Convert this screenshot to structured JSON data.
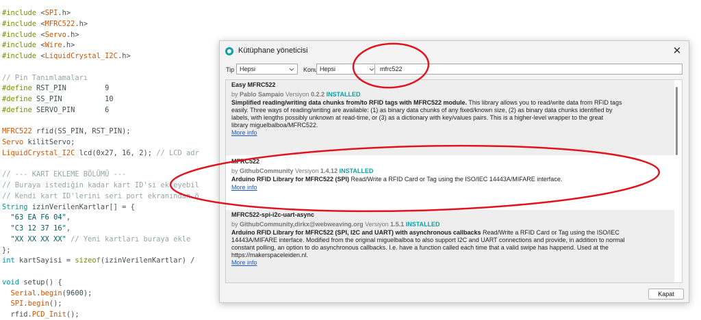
{
  "code": {
    "lines": [
      [
        {
          "c": "kw",
          "t": "#include "
        },
        {
          "c": "",
          "t": "<"
        },
        {
          "c": "lib",
          "t": "SPI"
        },
        {
          "c": "",
          "t": ".h>"
        }
      ],
      [
        {
          "c": "kw",
          "t": "#include "
        },
        {
          "c": "",
          "t": "<"
        },
        {
          "c": "lib",
          "t": "MFRC522"
        },
        {
          "c": "",
          "t": ".h>"
        }
      ],
      [
        {
          "c": "kw",
          "t": "#include "
        },
        {
          "c": "",
          "t": "<"
        },
        {
          "c": "lib",
          "t": "Servo"
        },
        {
          "c": "",
          "t": ".h>"
        }
      ],
      [
        {
          "c": "kw",
          "t": "#include "
        },
        {
          "c": "",
          "t": "<"
        },
        {
          "c": "lib",
          "t": "Wire"
        },
        {
          "c": "",
          "t": ".h>"
        }
      ],
      [
        {
          "c": "kw",
          "t": "#include "
        },
        {
          "c": "",
          "t": "<"
        },
        {
          "c": "lib",
          "t": "LiquidCrystal_I2C"
        },
        {
          "c": "",
          "t": ".h>"
        }
      ],
      [],
      [
        {
          "c": "cm",
          "t": "// Pin Tanımlamaları"
        }
      ],
      [
        {
          "c": "kw",
          "t": "#define "
        },
        {
          "c": "",
          "t": "RST_PIN         9"
        }
      ],
      [
        {
          "c": "kw",
          "t": "#define "
        },
        {
          "c": "",
          "t": "SS_PIN          10"
        }
      ],
      [
        {
          "c": "kw",
          "t": "#define "
        },
        {
          "c": "",
          "t": "SERVO_PIN       6"
        }
      ],
      [],
      [
        {
          "c": "lib",
          "t": "MFRC522"
        },
        {
          "c": "",
          "t": " rfid(SS_PIN, RST_PIN);"
        }
      ],
      [
        {
          "c": "lib",
          "t": "Servo"
        },
        {
          "c": "",
          "t": " kilitServo;"
        }
      ],
      [
        {
          "c": "lib",
          "t": "LiquidCrystal_I2C"
        },
        {
          "c": "",
          "t": " lcd(0x27, 16, 2); "
        },
        {
          "c": "cm",
          "t": "// LCD adr"
        }
      ],
      [],
      [
        {
          "c": "cm",
          "t": "// --- KART EKLEME BÖLÜMÜ ---"
        }
      ],
      [
        {
          "c": "cm",
          "t": "// Buraya istediğin kadar kart ID'si ekleyebil"
        }
      ],
      [
        {
          "c": "cm",
          "t": "// Kendi kart ID'lerini seri port ekranından ö"
        }
      ],
      [
        {
          "c": "ty",
          "t": "String"
        },
        {
          "c": "",
          "t": " izinVerilenKartlar[] = {"
        }
      ],
      [
        {
          "c": "",
          "t": "  "
        },
        {
          "c": "st",
          "t": "\"63 EA F6 04\""
        },
        {
          "c": "",
          "t": ","
        }
      ],
      [
        {
          "c": "",
          "t": "  "
        },
        {
          "c": "st",
          "t": "\"C3 12 37 16\""
        },
        {
          "c": "",
          "t": ","
        }
      ],
      [
        {
          "c": "",
          "t": "  "
        },
        {
          "c": "st",
          "t": "\"XX XX XX XX\""
        },
        {
          "c": "",
          "t": " "
        },
        {
          "c": "cm",
          "t": "// Yeni kartları buraya ekle"
        }
      ],
      [
        {
          "c": "",
          "t": "};"
        }
      ],
      [
        {
          "c": "ty",
          "t": "int"
        },
        {
          "c": "",
          "t": " kartSayisi = "
        },
        {
          "c": "kw",
          "t": "sizeof"
        },
        {
          "c": "",
          "t": "(izinVerilenKartlar) /"
        }
      ],
      [],
      [
        {
          "c": "ty",
          "t": "void"
        },
        {
          "c": "",
          "t": " setup() {"
        }
      ],
      [
        {
          "c": "",
          "t": "  "
        },
        {
          "c": "lib",
          "t": "Serial"
        },
        {
          "c": "",
          "t": "."
        },
        {
          "c": "lib",
          "t": "begin"
        },
        {
          "c": "",
          "t": "(9600);"
        }
      ],
      [
        {
          "c": "",
          "t": "  "
        },
        {
          "c": "lib",
          "t": "SPI"
        },
        {
          "c": "",
          "t": "."
        },
        {
          "c": "lib",
          "t": "begin"
        },
        {
          "c": "",
          "t": "();"
        }
      ],
      [
        {
          "c": "",
          "t": "  rfid."
        },
        {
          "c": "lib",
          "t": "PCD_Init"
        },
        {
          "c": "",
          "t": "();"
        }
      ]
    ]
  },
  "dialog": {
    "title": "Kütüphane yöneticisi",
    "close_glyph": "✕",
    "filters": {
      "tip_label": "Tip",
      "tip_value": "Hepsi",
      "konu_label": "Konu",
      "konu_value": "Hepsi",
      "search_value": "mfrc522"
    },
    "libraries": [
      {
        "name": "Easy MFRC522",
        "by_prefix": "by ",
        "author": "Pablo Sampaio",
        "version_label": " Versiyon ",
        "version": "0.2.2",
        "installed": "INSTALLED",
        "desc_bold": "Simplified reading/writing data chunks from/to RFID tags with MFRC522 module.",
        "desc_lines": [
          " This library allows you to read/write data from RFID tags",
          "easily. Three ways of reading/writing are available: (1) as binary data chunks of any fixed/known size, (2) as binary data chunks identified by",
          "labels, with lengths possibly unknown at read-time, or (3) as a dictionary with key/values pairs. This is a higher-level wrapper to the great",
          "library miguelbalboa/MFRC522."
        ],
        "more": "More info"
      },
      {
        "name": "MFRC522",
        "by_prefix": "by ",
        "author": "GithubCommunity",
        "version_label": " Versiyon ",
        "version": "1.4.12",
        "installed": "INSTALLED",
        "desc_bold": "Arduino RFID Library for MFRC522 (SPI)",
        "desc_lines": [
          " Read/Write a RFID Card or Tag using the ISO/IEC 14443A/MIFARE interface."
        ],
        "more": "More info"
      },
      {
        "name": "MFRC522-spi-i2c-uart-async",
        "by_prefix": "by ",
        "author": "GithubCommunity,dirkx@webweaving.org",
        "version_label": " Versiyon ",
        "version": "1.5.1",
        "installed": "INSTALLED",
        "desc_bold": "Arduino RFID Library for MFRC522 (SPI, I2C and UART) with asynchronous callbacks",
        "desc_lines": [
          " Read/Write a RFID Card or Tag using the ISO/IEC",
          "14443A/MIFARE interface. Modified from the original miguelbalboa to also support I2C and UART connections and provide, in addition to normal",
          "constant polling, an option to do asynchronous callbacks. I.e. have a function called each time that a valid swipe has happend. Used at the",
          "https://makerspaceleiden.nl."
        ],
        "more": "More info"
      }
    ],
    "close_button": "Kapat"
  },
  "colors": {
    "annotation": "#e0141e",
    "installed": "#0ca1a6",
    "link": "#1a55c6"
  }
}
